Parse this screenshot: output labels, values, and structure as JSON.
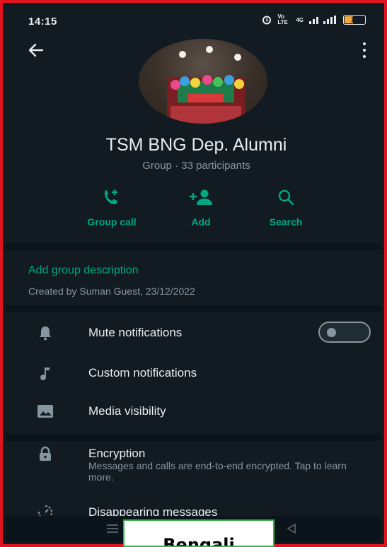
{
  "status_bar": {
    "time": "14:15",
    "network_text": "Vo LTE",
    "network_gen": "4G",
    "battery": "18"
  },
  "group": {
    "name": "TSM BNG Dep. Alumni",
    "subtitle": "Group · 33 participants"
  },
  "actions": [
    {
      "label": "Group call",
      "icon": "phone-add-icon"
    },
    {
      "label": "Add",
      "icon": "add-person-icon"
    },
    {
      "label": "Search",
      "icon": "search-icon"
    }
  ],
  "description": {
    "add_label": "Add group description",
    "created": "Created by Suman Guest, 23/12/2022"
  },
  "settings": [
    {
      "label": "Mute notifications",
      "icon": "bell-icon",
      "toggle_on": false
    },
    {
      "label": "Custom notifications",
      "icon": "music-note-icon"
    },
    {
      "label": "Media visibility",
      "icon": "image-icon"
    },
    {
      "label": "Encryption",
      "icon": "lock-icon",
      "sub": "Messages and calls are end-to-end encrypted. Tap to learn more."
    },
    {
      "label": "Disappearing messages",
      "icon": "timer-icon"
    }
  ],
  "overlay": {
    "language": "Bengali"
  },
  "colors": {
    "accent": "#00a884",
    "background": "#121b22",
    "frame": "#e0141e",
    "text": "#e9edef",
    "muted": "#8696a0"
  }
}
